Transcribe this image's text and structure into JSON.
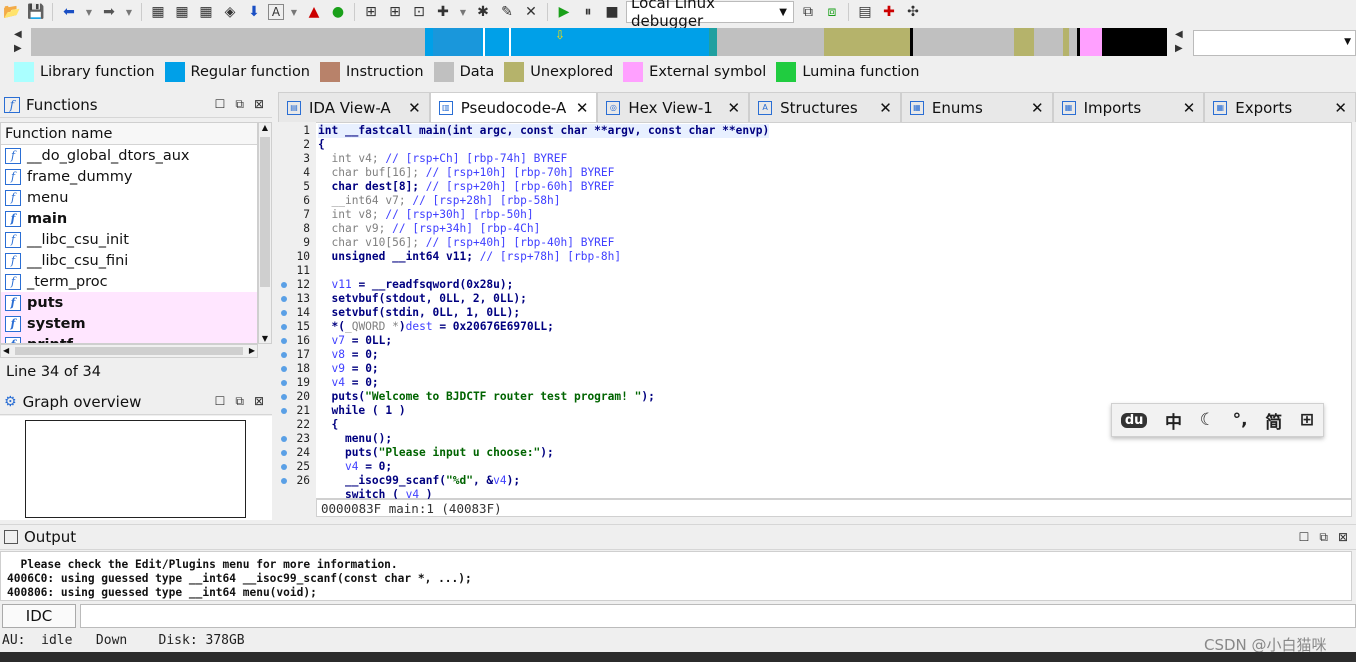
{
  "toolbar": {
    "debugger_select": "Local Linux debugger"
  },
  "legend": [
    {
      "label": "Library function",
      "color": "#aaffff"
    },
    {
      "label": "Regular function",
      "color": "#00a0e8"
    },
    {
      "label": "Instruction",
      "color": "#b8826a"
    },
    {
      "label": "Data",
      "color": "#c0c0c0"
    },
    {
      "label": "Unexplored",
      "color": "#b5b36b"
    },
    {
      "label": "External symbol",
      "color": "#ffa0ff"
    },
    {
      "label": "Lumina function",
      "color": "#20cc40"
    }
  ],
  "functions_panel": {
    "title": "Functions",
    "column": "Function name",
    "items": [
      {
        "name": "__do_global_dtors_aux",
        "style": "normal"
      },
      {
        "name": "frame_dummy",
        "style": "normal"
      },
      {
        "name": "menu",
        "style": "normal"
      },
      {
        "name": "main",
        "style": "bold"
      },
      {
        "name": "__libc_csu_init",
        "style": "normal"
      },
      {
        "name": "__libc_csu_fini",
        "style": "normal"
      },
      {
        "name": "_term_proc",
        "style": "normal"
      },
      {
        "name": "puts",
        "style": "ext"
      },
      {
        "name": "system",
        "style": "ext"
      },
      {
        "name": "printf",
        "style": "ext"
      }
    ],
    "status": "Line 34 of 34"
  },
  "graph_overview": {
    "title": "Graph overview"
  },
  "tabs": [
    {
      "label": "IDA View-A",
      "active": false
    },
    {
      "label": "Pseudocode-A",
      "active": true
    },
    {
      "label": "Hex View-1",
      "active": false
    },
    {
      "label": "Structures",
      "active": false
    },
    {
      "label": "Enums",
      "active": false
    },
    {
      "label": "Imports",
      "active": false
    },
    {
      "label": "Exports",
      "active": false
    }
  ],
  "code_lines": [
    {
      "n": "1",
      "dot": false,
      "html": "<span class=\"kw\">int __fastcall main(int argc, const char **argv, const char **envp)</span>"
    },
    {
      "n": "2",
      "dot": false,
      "html": "<span class=\"kw\">{</span>"
    },
    {
      "n": "3",
      "dot": false,
      "html": "  <span class=\"gr\">int v4;</span> <span class=\"bl\">// [rsp+Ch] [rbp-74h] BYREF</span>"
    },
    {
      "n": "4",
      "dot": false,
      "html": "  <span class=\"gr\">char buf[16];</span> <span class=\"bl\">// [rsp+10h] [rbp-70h] BYREF</span>"
    },
    {
      "n": "5",
      "dot": false,
      "html": "  <span class=\"kw\">char dest[8];</span> <span class=\"bl\">// [rsp+20h] [rbp-60h] BYREF</span>"
    },
    {
      "n": "6",
      "dot": false,
      "html": "  <span class=\"gr\">__int64 v7;</span> <span class=\"bl\">// [rsp+28h] [rbp-58h]</span>"
    },
    {
      "n": "7",
      "dot": false,
      "html": "  <span class=\"gr\">int v8;</span> <span class=\"bl\">// [rsp+30h] [rbp-50h]</span>"
    },
    {
      "n": "8",
      "dot": false,
      "html": "  <span class=\"gr\">char v9;</span> <span class=\"bl\">// [rsp+34h] [rbp-4Ch]</span>"
    },
    {
      "n": "9",
      "dot": false,
      "html": "  <span class=\"gr\">char v10[56];</span> <span class=\"bl\">// [rsp+40h] [rbp-40h] BYREF</span>"
    },
    {
      "n": "10",
      "dot": false,
      "html": "  <span class=\"kw\">unsigned __int64 v11;</span> <span class=\"bl\">// [rsp+78h] [rbp-8h]</span>"
    },
    {
      "n": "11",
      "dot": false,
      "html": ""
    },
    {
      "n": "12",
      "dot": true,
      "html": "  <span class=\"bl\">v11</span> <span class=\"kw\">= __readfsqword(0x28u);</span>"
    },
    {
      "n": "13",
      "dot": true,
      "html": "  <span class=\"kw\">setvbuf(stdout, 0LL, 2, 0LL);</span>"
    },
    {
      "n": "14",
      "dot": true,
      "html": "  <span class=\"kw\">setvbuf(stdin, 0LL, 1, 0LL);</span>"
    },
    {
      "n": "15",
      "dot": true,
      "html": "  <span class=\"kw\">*(</span><span class=\"gr\">_QWORD *</span><span class=\"kw\">)</span><span class=\"bl\">dest</span> <span class=\"kw\">= 0x20676E6970LL;</span>"
    },
    {
      "n": "16",
      "dot": true,
      "html": "  <span class=\"bl\">v7</span> <span class=\"kw\">= 0LL;</span>"
    },
    {
      "n": "17",
      "dot": true,
      "html": "  <span class=\"bl\">v8</span> <span class=\"kw\">= 0;</span>"
    },
    {
      "n": "18",
      "dot": true,
      "html": "  <span class=\"bl\">v9</span> <span class=\"kw\">= 0;</span>"
    },
    {
      "n": "19",
      "dot": true,
      "html": "  <span class=\"bl\">v4</span> <span class=\"kw\">= 0;</span>"
    },
    {
      "n": "20",
      "dot": true,
      "html": "  <span class=\"kw\">puts(</span><span class=\"st\">\"Welcome to BJDCTF router test program! \"</span><span class=\"kw\">);</span>"
    },
    {
      "n": "21",
      "dot": true,
      "html": "  <span class=\"kw\">while ( 1 )</span>"
    },
    {
      "n": "22",
      "dot": false,
      "html": "  <span class=\"kw\">{</span>"
    },
    {
      "n": "23",
      "dot": true,
      "html": "    <span class=\"kw\">menu();</span>"
    },
    {
      "n": "24",
      "dot": true,
      "html": "    <span class=\"kw\">puts(</span><span class=\"st\">\"Please input u choose:\"</span><span class=\"kw\">);</span>"
    },
    {
      "n": "25",
      "dot": true,
      "html": "    <span class=\"bl\">v4</span> <span class=\"kw\">= 0;</span>"
    },
    {
      "n": "26",
      "dot": true,
      "html": "    <span class=\"kw\">__isoc99_scanf(</span><span class=\"st\">\"%d\"</span><span class=\"kw\">, &amp;</span><span class=\"bl\">v4</span><span class=\"kw\">);</span>"
    },
    {
      "n": "",
      "dot": false,
      "html": "    <span class=\"kw\">switch ( </span><span class=\"bl\">v4</span><span class=\"kw\"> )</span>"
    }
  ],
  "code_status": "0000083F main:1 (40083F)",
  "ime": [
    "du",
    "中",
    "☾",
    "°,",
    "简",
    "⊞"
  ],
  "output": {
    "title": "Output",
    "lines": [
      "  Please check the Edit/Plugins menu for more information.",
      "4006C0: using guessed type __int64 __isoc99_scanf(const char *, ...);",
      "400806: using guessed type __int64 menu(void);"
    ],
    "idc_label": "IDC"
  },
  "statusbar": "AU:  idle   Down    Disk: 378GB",
  "watermark": "CSDN @小白猫咪"
}
